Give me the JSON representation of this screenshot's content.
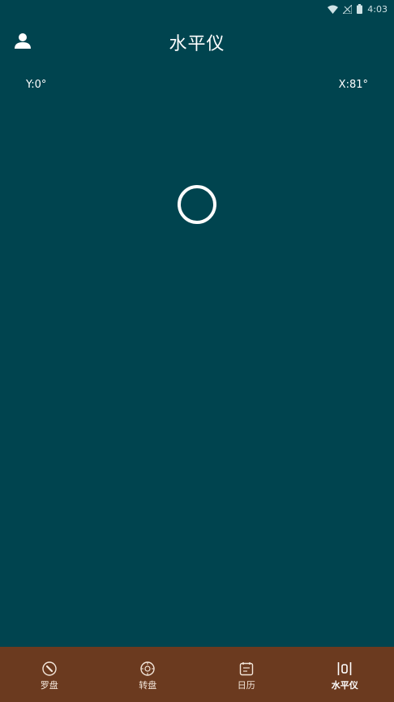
{
  "status_bar": {
    "time": "4:03"
  },
  "header": {
    "title": "水平仪"
  },
  "level": {
    "y_angle": "Y:0°",
    "x_angle": "X:81°"
  },
  "bottom_nav": {
    "items": [
      {
        "label": "罗盘",
        "icon": "compass-icon"
      },
      {
        "label": "转盘",
        "icon": "wheel-icon"
      },
      {
        "label": "日历",
        "icon": "calendar-icon"
      },
      {
        "label": "水平仪",
        "icon": "level-icon",
        "active": true
      }
    ]
  },
  "colors": {
    "background": "#00444f",
    "nav_background": "#6b3a1f",
    "text": "#ffffff"
  }
}
